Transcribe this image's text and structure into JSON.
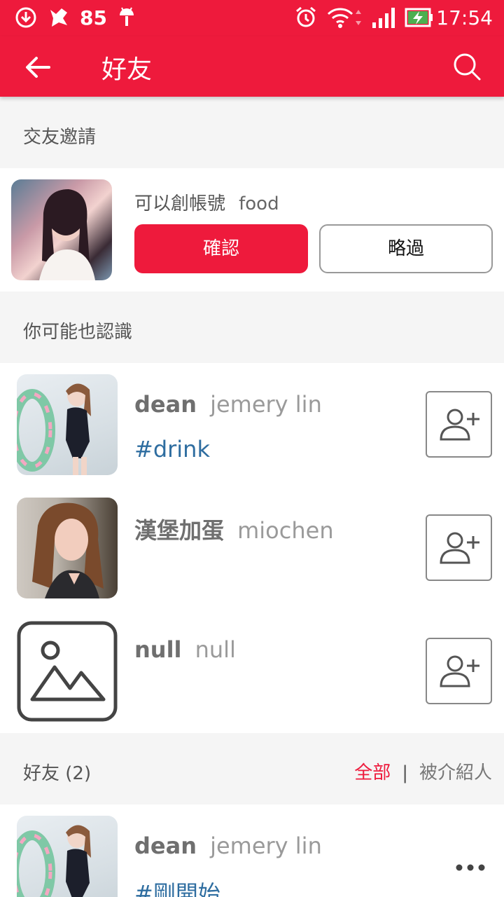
{
  "status_bar": {
    "notification_count": "85",
    "time": "17:54"
  },
  "app_bar": {
    "title": "好友"
  },
  "friend_requests": {
    "section_title": "交友邀請",
    "items": [
      {
        "name": "可以創帳號",
        "username": "food",
        "confirm_label": "確認",
        "skip_label": "略過"
      }
    ]
  },
  "suggestions": {
    "section_title": "你可能也認識",
    "items": [
      {
        "name": "dean",
        "username": "jemery lin",
        "tag": "#drink"
      },
      {
        "name": "漢堡加蛋",
        "username": "miochen",
        "tag": ""
      },
      {
        "name": "null",
        "username": "null",
        "tag": ""
      }
    ]
  },
  "friends": {
    "section_title": "好友 (2)",
    "filter_all": "全部",
    "filter_separator": "|",
    "filter_referred": "被介紹人",
    "items": [
      {
        "name": "dean",
        "username": "jemery lin",
        "tag": "#剛開始"
      }
    ]
  },
  "colors": {
    "brand": "#ee1a3c",
    "tag": "#2e6da0"
  },
  "icons": {
    "back": "arrow-left-icon",
    "search": "search-icon",
    "add_friend": "person-add-icon",
    "more": "more-horizontal-icon",
    "image_placeholder": "image-placeholder-icon"
  }
}
